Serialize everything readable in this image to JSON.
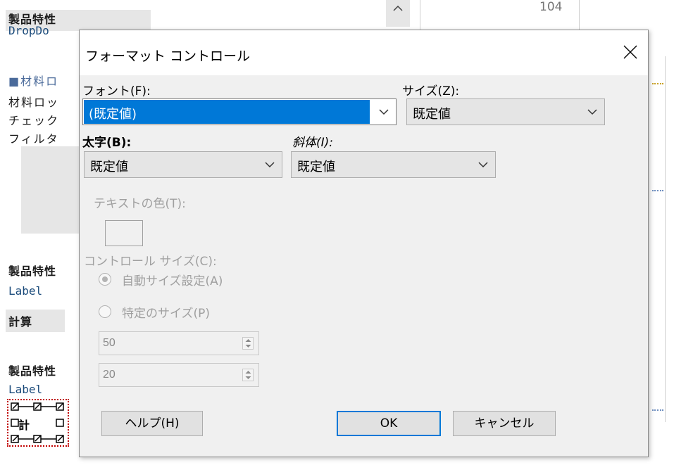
{
  "background": {
    "top_label": "製品特性",
    "top_mono": "DropDo",
    "section_label": "■材料ロ",
    "lines": [
      "材料ロッ",
      "チェック",
      "フィルタ"
    ],
    "label2": "製品特性",
    "mono2": "Label",
    "calc": "計算",
    "label3": "製品特性",
    "mono3": "Label",
    "box_center": "計",
    "ruler_value": "104"
  },
  "dialog": {
    "title": "フォーマット コントロール",
    "font_label": "フォント(F):",
    "font_value": "(既定値)",
    "size_label": "サイズ(Z):",
    "size_value": "既定値",
    "bold_label": "太字(B):",
    "bold_value": "既定値",
    "italic_label": "斜体(I):",
    "italic_value": "既定値",
    "text_color_label": "テキストの色(T):",
    "control_size_label": "コントロール サイズ(C):",
    "auto_size_label": "自動サイズ設定(A)",
    "specific_size_label": "特定のサイズ(P)",
    "width_value": "50",
    "height_value": "20",
    "help_button": "ヘルプ(H)",
    "ok_button": "OK",
    "cancel_button": "キャンセル"
  },
  "colors": {
    "selection": "#0078d7",
    "dialog_bg": "#f0f0f0",
    "disabled_text": "#a0a0a0"
  }
}
